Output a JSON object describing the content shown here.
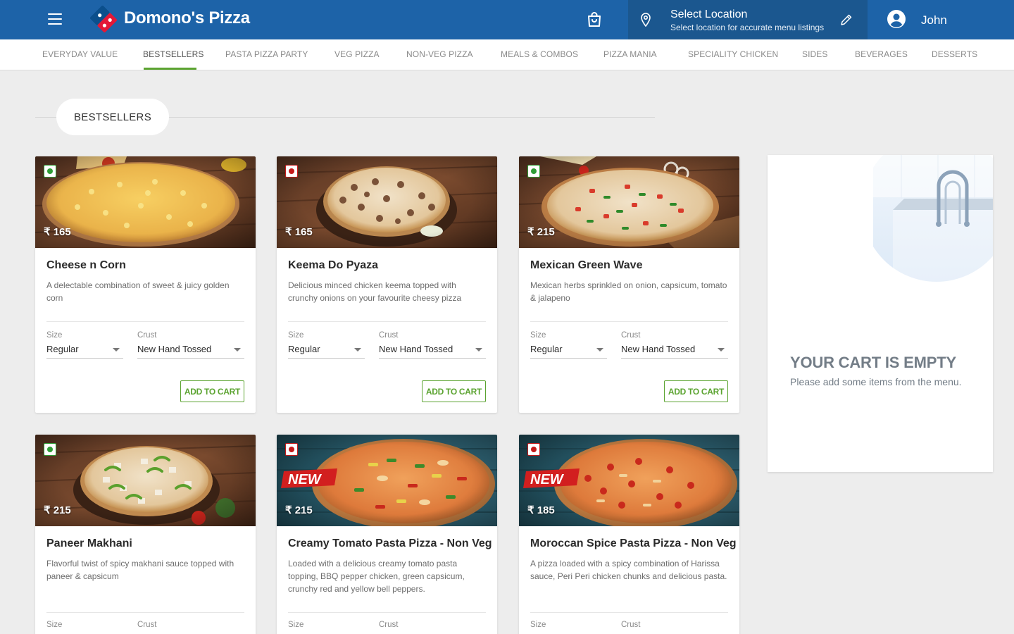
{
  "header": {
    "brand": "Domono's Pizza",
    "location_title": "Select Location",
    "location_subtitle": "Select location for accurate menu listings",
    "user_name": "John",
    "colors": {
      "bar": "#1d63a8",
      "location_panel": "#1b578f"
    }
  },
  "categories": [
    {
      "label": "EVERYDAY VALUE",
      "active": false
    },
    {
      "label": "BESTSELLERS",
      "active": true
    },
    {
      "label": "PASTA PIZZA PARTY",
      "active": false
    },
    {
      "label": "VEG PIZZA",
      "active": false
    },
    {
      "label": "NON-VEG PIZZA",
      "active": false
    },
    {
      "label": "MEALS & COMBOS",
      "active": false
    },
    {
      "label": "PIZZA MANIA",
      "active": false
    },
    {
      "label": "SPECIALITY CHICKEN",
      "active": false
    },
    {
      "label": "SIDES",
      "active": false
    },
    {
      "label": "BEVERAGES",
      "active": false
    },
    {
      "label": "DESSERTS",
      "active": false
    }
  ],
  "section": {
    "title": "BESTSELLERS"
  },
  "labels": {
    "size": "Size",
    "crust": "Crust",
    "add_to_cart": "ADD TO CART",
    "new_badge": "NEW"
  },
  "products": [
    {
      "name": "Cheese n Corn",
      "price": "₹ 165",
      "veg": true,
      "new": false,
      "description": "A delectable combination of sweet & juicy golden corn",
      "size": "Regular",
      "crust": "New Hand Tossed"
    },
    {
      "name": "Keema Do Pyaza",
      "price": "₹ 165",
      "veg": false,
      "new": false,
      "description": "Delicious minced chicken keema topped with crunchy onions on your favourite cheesy pizza",
      "size": "Regular",
      "crust": "New Hand Tossed"
    },
    {
      "name": "Mexican Green Wave",
      "price": "₹ 215",
      "veg": true,
      "new": false,
      "description": "Mexican herbs sprinkled on onion, capsicum, tomato & jalapeno",
      "size": "Regular",
      "crust": "New Hand Tossed"
    },
    {
      "name": "Paneer Makhani",
      "price": "₹ 215",
      "veg": true,
      "new": false,
      "description": "Flavorful twist of spicy makhani sauce topped with paneer & capsicum",
      "size": "",
      "crust": ""
    },
    {
      "name": "Creamy Tomato Pasta Pizza - Non Veg",
      "price": "₹ 215",
      "veg": false,
      "new": true,
      "description": "Loaded with a delicious creamy tomato pasta topping, BBQ pepper chicken, green capsicum, crunchy red and yellow bell peppers.",
      "size": "",
      "crust": ""
    },
    {
      "name": "Moroccan Spice Pasta Pizza - Non Veg",
      "price": "₹ 185",
      "veg": false,
      "new": true,
      "description": "A pizza loaded with a spicy combination of Harissa sauce, Peri Peri chicken chunks and delicious pasta.",
      "size": "",
      "crust": ""
    }
  ],
  "cart": {
    "title": "YOUR CART IS EMPTY",
    "subtitle": "Please add some items from the menu."
  },
  "colors": {
    "veg": "#2f9e36",
    "non_veg": "#c41a1a",
    "accent_green": "#5ba330"
  }
}
